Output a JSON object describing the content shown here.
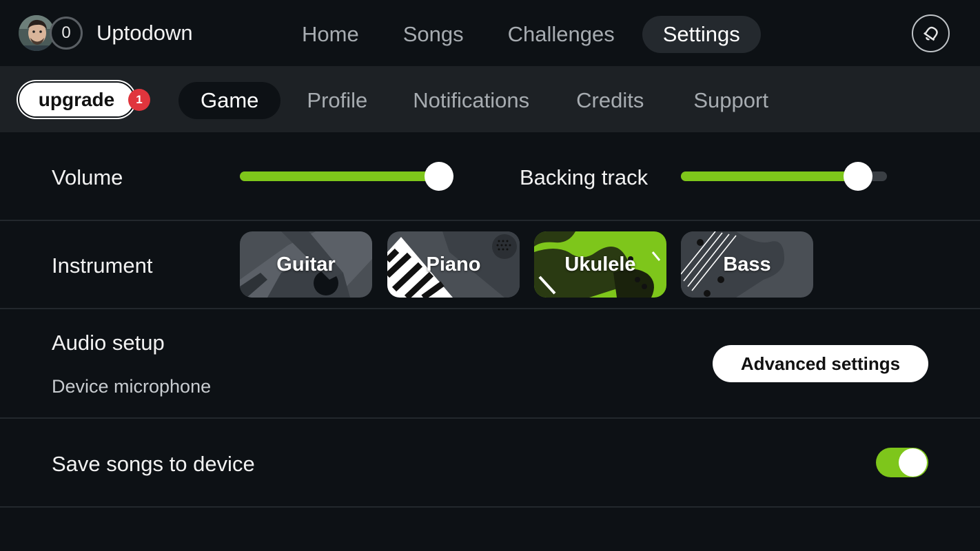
{
  "header": {
    "level": "0",
    "username": "Uptodown",
    "nav": [
      {
        "label": "Home",
        "active": false
      },
      {
        "label": "Songs",
        "active": false
      },
      {
        "label": "Challenges",
        "active": false
      },
      {
        "label": "Settings",
        "active": true
      }
    ],
    "notification_icon": "bell-icon"
  },
  "subnav": {
    "upgrade_label": "upgrade",
    "upgrade_badge": "1",
    "tabs": [
      {
        "label": "Game",
        "active": true
      },
      {
        "label": "Profile",
        "active": false
      },
      {
        "label": "Notifications",
        "active": false
      },
      {
        "label": "Credits",
        "active": false
      },
      {
        "label": "Support",
        "active": false
      }
    ]
  },
  "settings": {
    "volume": {
      "label": "Volume",
      "value": 0.94
    },
    "backing_track": {
      "label": "Backing track",
      "value": 0.86
    },
    "instrument": {
      "label": "Instrument",
      "options": [
        {
          "label": "Guitar",
          "selected": false
        },
        {
          "label": "Piano",
          "selected": false
        },
        {
          "label": "Ukulele",
          "selected": true
        },
        {
          "label": "Bass",
          "selected": false
        }
      ]
    },
    "audio_setup": {
      "label": "Audio setup",
      "device": "Device microphone",
      "button_label": "Advanced settings"
    },
    "save_songs": {
      "label": "Save songs to device",
      "enabled": true
    }
  },
  "colors": {
    "background": "#0d1115",
    "subbar": "#1d2125",
    "accent": "#7ec61b",
    "badge": "#e0353d"
  }
}
